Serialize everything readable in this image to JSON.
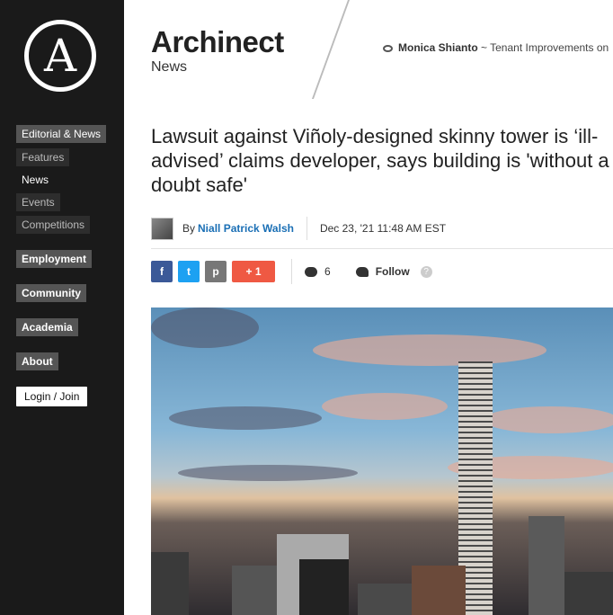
{
  "sidebar": {
    "logo_letter": "A",
    "items": [
      {
        "label": "Editorial & News",
        "type": "section"
      },
      {
        "label": "Features",
        "type": "sub"
      },
      {
        "label": "News",
        "type": "sub-current"
      },
      {
        "label": "Events",
        "type": "sub"
      },
      {
        "label": "Competitions",
        "type": "sub"
      },
      {
        "label": "Employment",
        "type": "section"
      },
      {
        "label": "Community",
        "type": "section"
      },
      {
        "label": "Academia",
        "type": "section"
      },
      {
        "label": "About",
        "type": "section"
      }
    ],
    "login_label": "Login / Join"
  },
  "header": {
    "brand": "Archinect",
    "section": "News",
    "ticker_name": "Monica Shianto",
    "ticker_rest": " ~ Tenant Improvements on"
  },
  "article": {
    "headline": "Lawsuit against Viñoly-designed skinny tower is ‘ill-advised’ claims developer, says building is 'without a doubt safe'",
    "by": "By",
    "author": "Niall Patrick Walsh",
    "date": "Dec 23, '21 11:48 AM EST"
  },
  "share": {
    "facebook": "f",
    "twitter": "t",
    "print": "p",
    "plus": "+ 1",
    "comment_count": "6",
    "follow_label": "Follow",
    "help": "?"
  },
  "icons": [
    "eye-icon",
    "facebook-icon",
    "twitter-icon",
    "print-icon",
    "comment-icon",
    "follow-icon",
    "help-icon"
  ],
  "colors": {
    "link": "#1a6fb5",
    "facebook": "#3b5998",
    "twitter": "#1da1f2",
    "plus": "#ef5943"
  }
}
